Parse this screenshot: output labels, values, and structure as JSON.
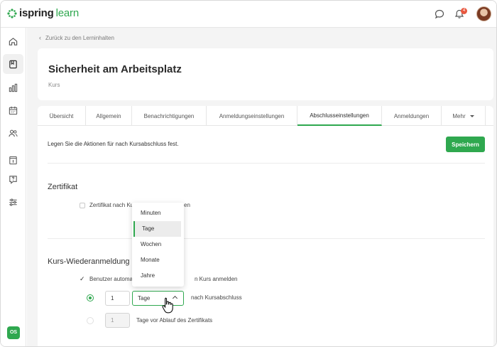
{
  "app": {
    "logo_bold": "ispring",
    "logo_light": "learn",
    "notification_count": "4",
    "brand_color": "#2fa84f"
  },
  "sidebar": {
    "items": [
      {
        "icon": "home-icon"
      },
      {
        "icon": "book-icon",
        "active": true
      },
      {
        "icon": "chart-icon"
      },
      {
        "icon": "calendar-icon"
      },
      {
        "icon": "users-icon"
      },
      {
        "icon": "course-calendar-icon"
      },
      {
        "icon": "help-icon"
      },
      {
        "icon": "settings-sliders-icon"
      }
    ],
    "user_initials": "OS"
  },
  "breadcrumb": {
    "back_label": "Zurück zu den Lerninhalten"
  },
  "course": {
    "title": "Sicherheit am Arbeitsplatz",
    "type": "Kurs"
  },
  "tabs": [
    {
      "label": "Übersicht"
    },
    {
      "label": "Allgemein"
    },
    {
      "label": "Benachrichtigungen"
    },
    {
      "label": "Anmeldungseinstellungen"
    },
    {
      "label": "Abschlusseinstellungen",
      "active": true
    },
    {
      "label": "Anmeldungen"
    },
    {
      "label": "Mehr"
    }
  ],
  "settings": {
    "intro": "Legen Sie die Aktionen für nach Kursabschluss fest.",
    "save_label": "Speichern",
    "certificate": {
      "title": "Zertifikat",
      "checkbox_label_left": "Zertifikat nach Ku",
      "checkbox_label_right": "en",
      "checked": false
    },
    "reenroll": {
      "title": "Kurs-Wiederanmeldung",
      "checkbox_label_left": "Benutzer automa",
      "checkbox_label_right": "n Kurs anmelden",
      "checked": true,
      "option1": {
        "value": "1",
        "unit": "Tage",
        "suffix": "nach Kursabschluss",
        "selected": true
      },
      "option2": {
        "value": "1",
        "suffix": "Tage vor Ablauf des Zertifikats",
        "selected": false
      }
    }
  },
  "dropdown": {
    "options": [
      "Minuten",
      "Tage",
      "Wochen",
      "Monate",
      "Jahre"
    ],
    "selected": "Tage"
  }
}
